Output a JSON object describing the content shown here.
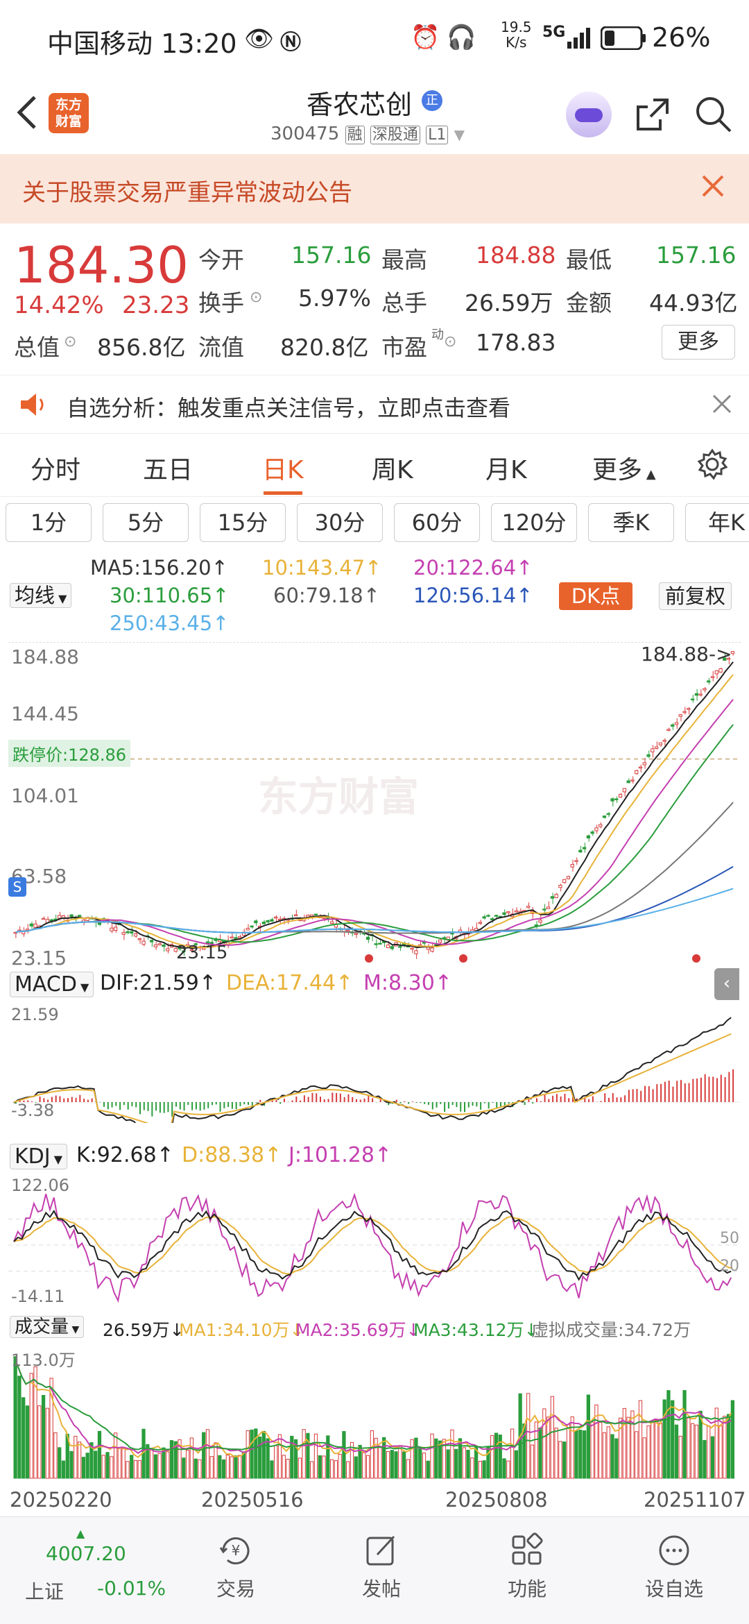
{
  "status_bar": {
    "carrier_time": "中国移动 13:20",
    "net_speed_top": "19.5",
    "net_speed_bot": "K/s",
    "signal": "5G",
    "battery": "26%"
  },
  "header": {
    "logo_top": "东方",
    "logo_bot": "财富",
    "stock_name": "香农芯创",
    "badge": "正",
    "code": "300475",
    "tags": [
      "融",
      "深股通",
      "L1"
    ]
  },
  "notice": {
    "text": "关于股票交易严重异常波动公告"
  },
  "quote": {
    "price": "184.30",
    "pct": "14.42%",
    "change": "23.23",
    "open_label": "今开",
    "open": "157.16",
    "high_label": "最高",
    "high": "184.88",
    "low_label": "最低",
    "low": "157.16",
    "turnover_label": "换手",
    "turnover": "5.97%",
    "vol_label": "总手",
    "vol": "26.59万",
    "amount_label": "金额",
    "amount": "44.93亿",
    "mcap_label": "总值",
    "mcap": "856.8亿",
    "float_label": "流值",
    "float": "820.8亿",
    "pe_label": "市盈",
    "pe_sup": "动",
    "pe": "178.83",
    "more": "更多"
  },
  "alert": {
    "text": "自选分析：触发重点关注信号，立即点击查看"
  },
  "tabs": [
    "分时",
    "五日",
    "日K",
    "周K",
    "月K",
    "更多"
  ],
  "active_tab": 2,
  "periods": [
    "1分",
    "5分",
    "15分",
    "30分",
    "60分",
    "120分",
    "季K",
    "年K"
  ],
  "ma": {
    "selector": "均线",
    "ma5": "MA5:156.20↑",
    "ma10": "10:143.47↑",
    "ma20": "20:122.64↑",
    "ma30": "30:110.65↑",
    "ma60": "60:79.18↑",
    "ma120": "120:56.14↑",
    "ma250": "250:43.45↑",
    "dk": "DK点",
    "fq": "前复权"
  },
  "kline": {
    "y_labels": [
      "184.88",
      "144.45",
      "104.01",
      "63.58",
      "23.15"
    ],
    "high_tag": "184.88->",
    "limit_down": "跌停价:128.86",
    "low_tag": "23.15",
    "watermark": "东方财富"
  },
  "macd": {
    "selector": "MACD",
    "dif": "DIF:21.59↑",
    "dea": "DEA:17.44↑",
    "m": "M:8.30↑",
    "top": "21.59",
    "bottom": "-3.38"
  },
  "kdj": {
    "selector": "KDJ",
    "k": "K:92.68↑",
    "d": "D:88.38↑",
    "j": "J:101.28↑",
    "top": "122.06",
    "bottom": "-14.11",
    "mid1": "50",
    "mid2": "20"
  },
  "volume": {
    "selector": "成交量",
    "vol": "26.59万↓",
    "ma1": "MA1:34.10万↓",
    "ma2": "MA2:35.69万↓",
    "ma3": "MA3:43.12万↓",
    "virtual": "虚拟成交量:34.72万",
    "top": "113.0万"
  },
  "dates": [
    "20250220",
    "20250516",
    "20250808",
    "20251107"
  ],
  "bottom_nav": {
    "index_value": "4007.20",
    "index_name": "上证",
    "index_pct": "-0.01%",
    "items": [
      "交易",
      "发帖",
      "功能",
      "设自选"
    ]
  },
  "colors": {
    "up": "#d83a3a",
    "down": "#2a9d3c",
    "accent": "#e8622c"
  }
}
